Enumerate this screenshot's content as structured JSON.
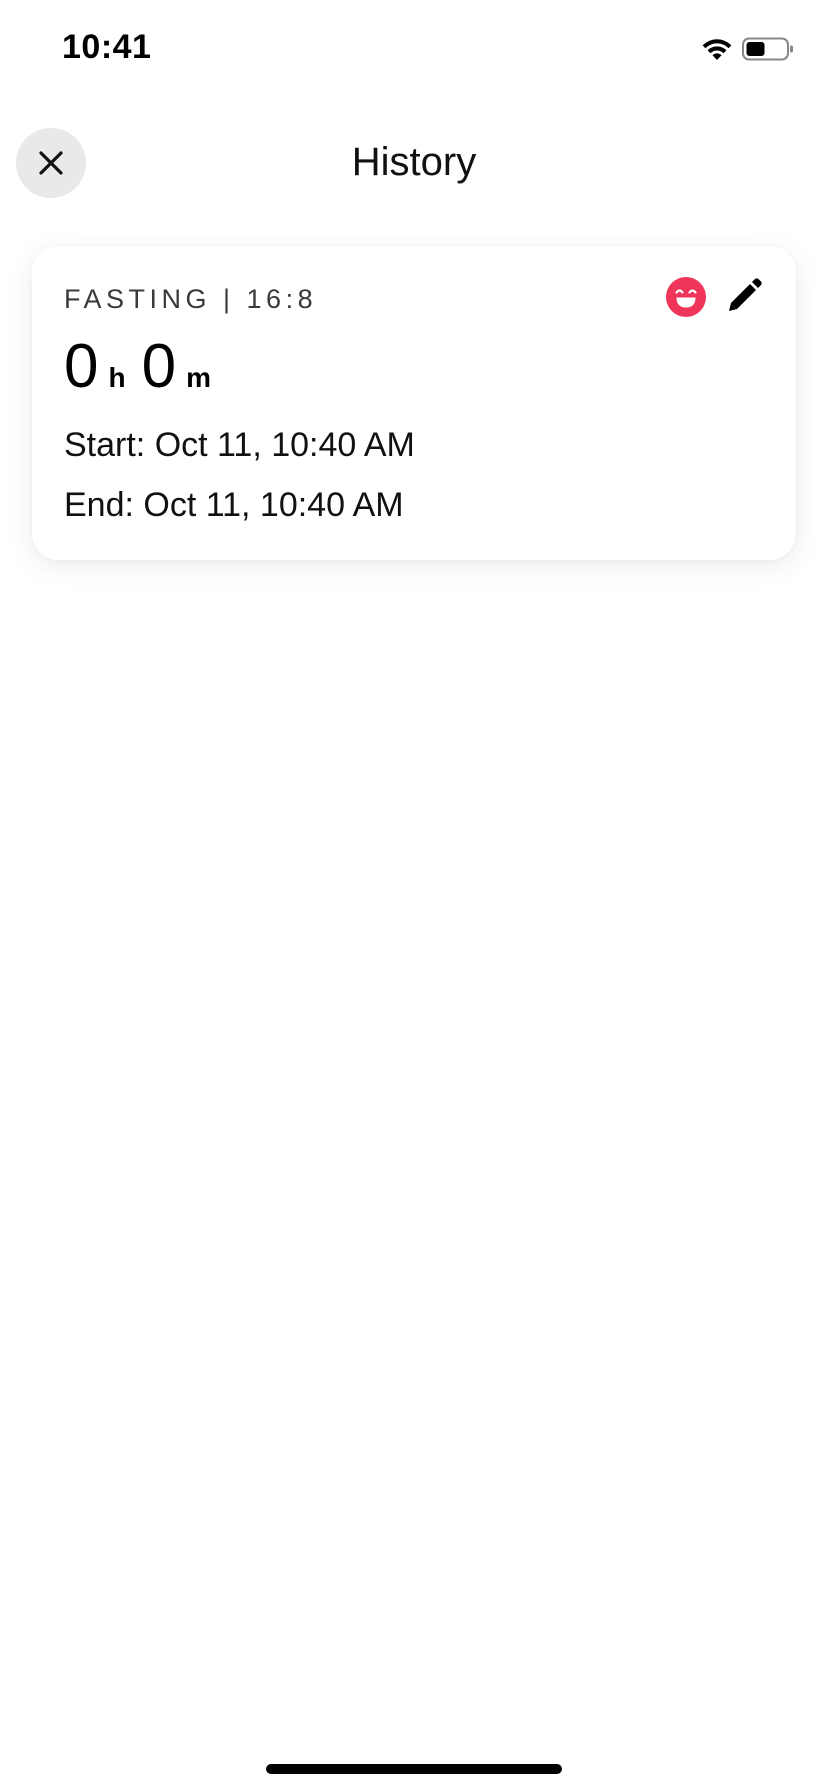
{
  "status_bar": {
    "time": "10:41"
  },
  "header": {
    "title": "History"
  },
  "entry": {
    "label": "FASTING | 16:8",
    "hours": "0",
    "hours_unit": "h",
    "minutes": "0",
    "minutes_unit": "m",
    "start": "Start: Oct 11, 10:40 AM",
    "end": "End: Oct 11, 10:40 AM",
    "mood_color": "#f0355a"
  }
}
